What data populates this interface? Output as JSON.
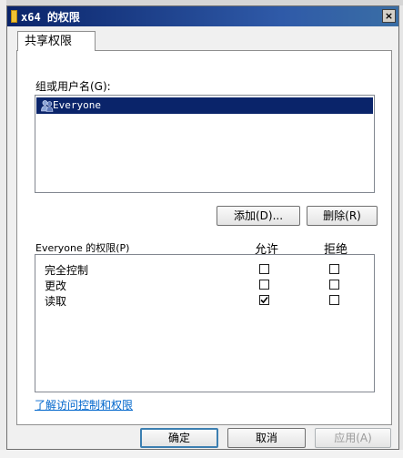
{
  "window": {
    "title": "x64 的权限",
    "close_glyph": "×"
  },
  "tabs": [
    {
      "label": "共享权限"
    }
  ],
  "users_section": {
    "label": "组或用户名(G):",
    "users": [
      {
        "name": "Everyone",
        "selected": true,
        "icon": "users-group-icon"
      }
    ],
    "add_button": "添加(D)...",
    "remove_button": "删除(R)"
  },
  "permissions": {
    "header_label": "Everyone 的权限(P)",
    "allow_header": "允许",
    "deny_header": "拒绝",
    "rows": [
      {
        "label": "完全控制",
        "allow": false,
        "deny": false
      },
      {
        "label": "更改",
        "allow": false,
        "deny": false
      },
      {
        "label": "读取",
        "allow": true,
        "deny": false
      }
    ]
  },
  "link": {
    "label": "了解访问控制和权限"
  },
  "footer": {
    "ok_label": "确定",
    "cancel_label": "取消",
    "apply_label": "应用(A)"
  },
  "colors": {
    "selection": "#0a246a",
    "link": "#0066cc",
    "title_gradient_start": "#0a246a"
  }
}
